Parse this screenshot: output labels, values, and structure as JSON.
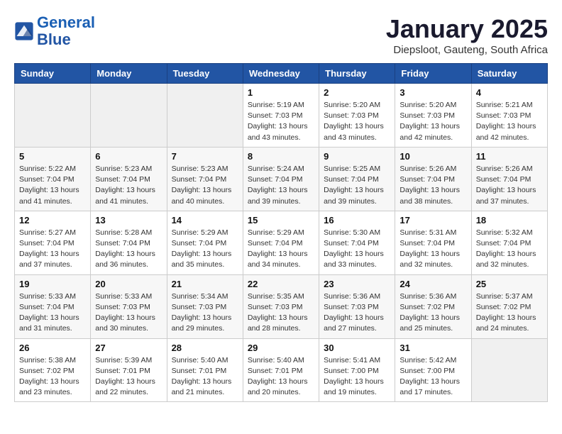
{
  "header": {
    "logo_line1": "General",
    "logo_line2": "Blue",
    "month": "January 2025",
    "location": "Diepsloot, Gauteng, South Africa"
  },
  "weekdays": [
    "Sunday",
    "Monday",
    "Tuesday",
    "Wednesday",
    "Thursday",
    "Friday",
    "Saturday"
  ],
  "weeks": [
    [
      {
        "day": "",
        "info": ""
      },
      {
        "day": "",
        "info": ""
      },
      {
        "day": "",
        "info": ""
      },
      {
        "day": "1",
        "info": "Sunrise: 5:19 AM\nSunset: 7:03 PM\nDaylight: 13 hours\nand 43 minutes."
      },
      {
        "day": "2",
        "info": "Sunrise: 5:20 AM\nSunset: 7:03 PM\nDaylight: 13 hours\nand 43 minutes."
      },
      {
        "day": "3",
        "info": "Sunrise: 5:20 AM\nSunset: 7:03 PM\nDaylight: 13 hours\nand 42 minutes."
      },
      {
        "day": "4",
        "info": "Sunrise: 5:21 AM\nSunset: 7:03 PM\nDaylight: 13 hours\nand 42 minutes."
      }
    ],
    [
      {
        "day": "5",
        "info": "Sunrise: 5:22 AM\nSunset: 7:04 PM\nDaylight: 13 hours\nand 41 minutes."
      },
      {
        "day": "6",
        "info": "Sunrise: 5:23 AM\nSunset: 7:04 PM\nDaylight: 13 hours\nand 41 minutes."
      },
      {
        "day": "7",
        "info": "Sunrise: 5:23 AM\nSunset: 7:04 PM\nDaylight: 13 hours\nand 40 minutes."
      },
      {
        "day": "8",
        "info": "Sunrise: 5:24 AM\nSunset: 7:04 PM\nDaylight: 13 hours\nand 39 minutes."
      },
      {
        "day": "9",
        "info": "Sunrise: 5:25 AM\nSunset: 7:04 PM\nDaylight: 13 hours\nand 39 minutes."
      },
      {
        "day": "10",
        "info": "Sunrise: 5:26 AM\nSunset: 7:04 PM\nDaylight: 13 hours\nand 38 minutes."
      },
      {
        "day": "11",
        "info": "Sunrise: 5:26 AM\nSunset: 7:04 PM\nDaylight: 13 hours\nand 37 minutes."
      }
    ],
    [
      {
        "day": "12",
        "info": "Sunrise: 5:27 AM\nSunset: 7:04 PM\nDaylight: 13 hours\nand 37 minutes."
      },
      {
        "day": "13",
        "info": "Sunrise: 5:28 AM\nSunset: 7:04 PM\nDaylight: 13 hours\nand 36 minutes."
      },
      {
        "day": "14",
        "info": "Sunrise: 5:29 AM\nSunset: 7:04 PM\nDaylight: 13 hours\nand 35 minutes."
      },
      {
        "day": "15",
        "info": "Sunrise: 5:29 AM\nSunset: 7:04 PM\nDaylight: 13 hours\nand 34 minutes."
      },
      {
        "day": "16",
        "info": "Sunrise: 5:30 AM\nSunset: 7:04 PM\nDaylight: 13 hours\nand 33 minutes."
      },
      {
        "day": "17",
        "info": "Sunrise: 5:31 AM\nSunset: 7:04 PM\nDaylight: 13 hours\nand 32 minutes."
      },
      {
        "day": "18",
        "info": "Sunrise: 5:32 AM\nSunset: 7:04 PM\nDaylight: 13 hours\nand 32 minutes."
      }
    ],
    [
      {
        "day": "19",
        "info": "Sunrise: 5:33 AM\nSunset: 7:04 PM\nDaylight: 13 hours\nand 31 minutes."
      },
      {
        "day": "20",
        "info": "Sunrise: 5:33 AM\nSunset: 7:03 PM\nDaylight: 13 hours\nand 30 minutes."
      },
      {
        "day": "21",
        "info": "Sunrise: 5:34 AM\nSunset: 7:03 PM\nDaylight: 13 hours\nand 29 minutes."
      },
      {
        "day": "22",
        "info": "Sunrise: 5:35 AM\nSunset: 7:03 PM\nDaylight: 13 hours\nand 28 minutes."
      },
      {
        "day": "23",
        "info": "Sunrise: 5:36 AM\nSunset: 7:03 PM\nDaylight: 13 hours\nand 27 minutes."
      },
      {
        "day": "24",
        "info": "Sunrise: 5:36 AM\nSunset: 7:02 PM\nDaylight: 13 hours\nand 25 minutes."
      },
      {
        "day": "25",
        "info": "Sunrise: 5:37 AM\nSunset: 7:02 PM\nDaylight: 13 hours\nand 24 minutes."
      }
    ],
    [
      {
        "day": "26",
        "info": "Sunrise: 5:38 AM\nSunset: 7:02 PM\nDaylight: 13 hours\nand 23 minutes."
      },
      {
        "day": "27",
        "info": "Sunrise: 5:39 AM\nSunset: 7:01 PM\nDaylight: 13 hours\nand 22 minutes."
      },
      {
        "day": "28",
        "info": "Sunrise: 5:40 AM\nSunset: 7:01 PM\nDaylight: 13 hours\nand 21 minutes."
      },
      {
        "day": "29",
        "info": "Sunrise: 5:40 AM\nSunset: 7:01 PM\nDaylight: 13 hours\nand 20 minutes."
      },
      {
        "day": "30",
        "info": "Sunrise: 5:41 AM\nSunset: 7:00 PM\nDaylight: 13 hours\nand 19 minutes."
      },
      {
        "day": "31",
        "info": "Sunrise: 5:42 AM\nSunset: 7:00 PM\nDaylight: 13 hours\nand 17 minutes."
      },
      {
        "day": "",
        "info": ""
      }
    ]
  ]
}
